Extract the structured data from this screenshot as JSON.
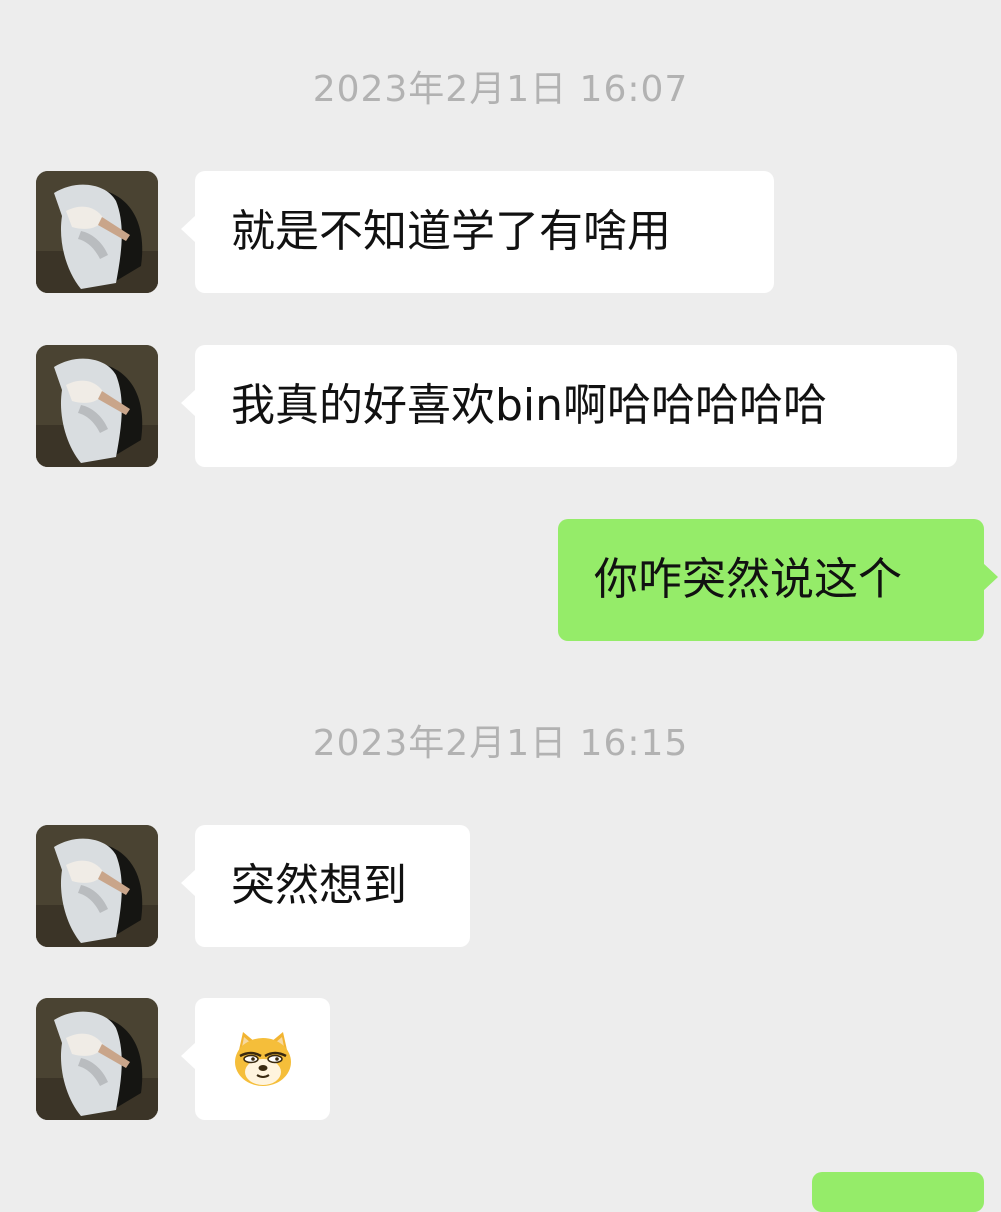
{
  "conversation": {
    "messages": [
      {
        "kind": "timestamp",
        "text": "2023年2月1日 16:07"
      },
      {
        "kind": "incoming",
        "text": "就是不知道学了有啥用"
      },
      {
        "kind": "incoming",
        "text": "我真的好喜欢bin啊哈哈哈哈哈"
      },
      {
        "kind": "outgoing",
        "text": "你咋突然说这个"
      },
      {
        "kind": "timestamp",
        "text": "2023年2月1日 16:15"
      },
      {
        "kind": "incoming",
        "text": "突然想到"
      },
      {
        "kind": "incoming-sticker",
        "sticker": "doge-emoji"
      },
      {
        "kind": "outgoing-partial"
      }
    ]
  },
  "colors": {
    "background": "#ededed",
    "incoming_bubble": "#ffffff",
    "outgoing_bubble": "#95ec69",
    "timestamp_text": "#b2b2b2",
    "message_text": "#111111"
  },
  "icons": {
    "avatar": "contact-avatar-photo",
    "sticker": "doge-emoji"
  }
}
